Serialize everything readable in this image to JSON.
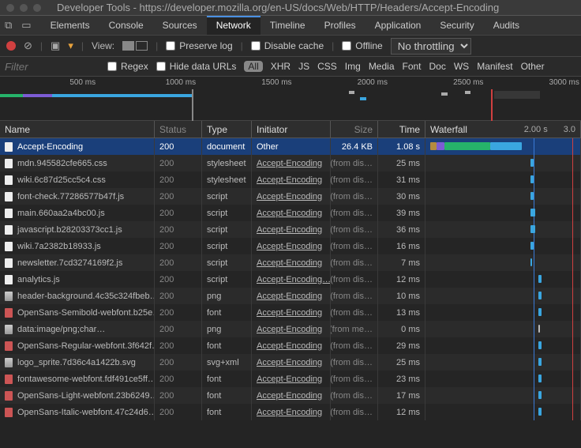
{
  "titlebar": {
    "title": "Developer Tools - https://developer.mozilla.org/en-US/docs/Web/HTTP/Headers/Accept-Encoding"
  },
  "tabs": {
    "items": [
      {
        "label": "Elements"
      },
      {
        "label": "Console"
      },
      {
        "label": "Sources"
      },
      {
        "label": "Network"
      },
      {
        "label": "Timeline"
      },
      {
        "label": "Profiles"
      },
      {
        "label": "Application"
      },
      {
        "label": "Security"
      },
      {
        "label": "Audits"
      }
    ],
    "active": 3
  },
  "toolbar": {
    "view_label": "View:",
    "preserve_log": "Preserve log",
    "disable_cache": "Disable cache",
    "offline": "Offline",
    "throttling": "No throttling"
  },
  "filter": {
    "placeholder": "Filter",
    "regex": "Regex",
    "hide_data": "Hide data URLs",
    "types": [
      "All",
      "XHR",
      "JS",
      "CSS",
      "Img",
      "Media",
      "Font",
      "Doc",
      "WS",
      "Manifest",
      "Other"
    ]
  },
  "overview": {
    "ticks": [
      "500 ms",
      "1000 ms",
      "1500 ms",
      "2000 ms",
      "2500 ms",
      "3000 ms"
    ]
  },
  "headers": {
    "name": "Name",
    "status": "Status",
    "type": "Type",
    "initiator": "Initiator",
    "size": "Size",
    "time": "Time",
    "waterfall": "Waterfall",
    "wf_t1": "2.00 s",
    "wf_t2": "3.0"
  },
  "rows": [
    {
      "name": "Accept-Encoding",
      "status": "200",
      "type": "document",
      "init": "Other",
      "init_u": false,
      "size": "26.4 KB",
      "time": "1.08 s",
      "icon": "doc",
      "selected": true,
      "wf": [
        {
          "l": 3,
          "w": 4,
          "c": "#b58b3f"
        },
        {
          "l": 7,
          "w": 5,
          "c": "#7c5cd4"
        },
        {
          "l": 12,
          "w": 30,
          "c": "#26b36a"
        },
        {
          "l": 42,
          "w": 20,
          "c": "#3aa6e0"
        }
      ]
    },
    {
      "name": "mdn.945582cfe665.css",
      "status": "200",
      "type": "stylesheet",
      "init": "Accept-Encoding",
      "init_u": true,
      "size": "(from dis…",
      "time": "25 ms",
      "icon": "doc",
      "wf": [
        {
          "l": 68,
          "w": 2,
          "c": "#3aa6e0"
        }
      ]
    },
    {
      "name": "wiki.6c87d25cc5c4.css",
      "status": "200",
      "type": "stylesheet",
      "init": "Accept-Encoding",
      "init_u": true,
      "size": "(from dis…",
      "time": "31 ms",
      "icon": "doc",
      "wf": [
        {
          "l": 68,
          "w": 2,
          "c": "#3aa6e0"
        }
      ]
    },
    {
      "name": "font-check.77286577b47f.js",
      "status": "200",
      "type": "script",
      "init": "Accept-Encoding",
      "init_u": true,
      "size": "(from dis…",
      "time": "30 ms",
      "icon": "doc",
      "wf": [
        {
          "l": 68,
          "w": 2,
          "c": "#3aa6e0"
        }
      ]
    },
    {
      "name": "main.660aa2a4bc00.js",
      "status": "200",
      "type": "script",
      "init": "Accept-Encoding",
      "init_u": true,
      "size": "(from dis…",
      "time": "39 ms",
      "icon": "doc",
      "wf": [
        {
          "l": 68,
          "w": 3,
          "c": "#3aa6e0"
        }
      ]
    },
    {
      "name": "javascript.b28203373cc1.js",
      "status": "200",
      "type": "script",
      "init": "Accept-Encoding",
      "init_u": true,
      "size": "(from dis…",
      "time": "36 ms",
      "icon": "doc",
      "wf": [
        {
          "l": 68,
          "w": 3,
          "c": "#3aa6e0"
        }
      ]
    },
    {
      "name": "wiki.7a2382b18933.js",
      "status": "200",
      "type": "script",
      "init": "Accept-Encoding",
      "init_u": true,
      "size": "(from dis…",
      "time": "16 ms",
      "icon": "doc",
      "wf": [
        {
          "l": 68,
          "w": 2,
          "c": "#3aa6e0"
        }
      ]
    },
    {
      "name": "newsletter.7cd3274169f2.js",
      "status": "200",
      "type": "script",
      "init": "Accept-Encoding",
      "init_u": true,
      "size": "(from dis…",
      "time": "7 ms",
      "icon": "doc",
      "wf": [
        {
          "l": 68,
          "w": 1,
          "c": "#3aa6e0"
        }
      ]
    },
    {
      "name": "analytics.js",
      "status": "200",
      "type": "script",
      "init": "Accept-Encoding…",
      "init_u": true,
      "size": "(from dis…",
      "time": "12 ms",
      "icon": "doc",
      "wf": [
        {
          "l": 73,
          "w": 2,
          "c": "#3aa6e0"
        }
      ]
    },
    {
      "name": "header-background.4c35c324fbeb…",
      "status": "200",
      "type": "png",
      "init": "Accept-Encoding",
      "init_u": true,
      "size": "(from dis…",
      "time": "10 ms",
      "icon": "img",
      "wf": [
        {
          "l": 73,
          "w": 2,
          "c": "#3aa6e0"
        }
      ]
    },
    {
      "name": "OpenSans-Semibold-webfont.b25e…",
      "status": "200",
      "type": "font",
      "init": "Accept-Encoding",
      "init_u": true,
      "size": "(from dis…",
      "time": "13 ms",
      "icon": "font",
      "wf": [
        {
          "l": 73,
          "w": 2,
          "c": "#3aa6e0"
        }
      ]
    },
    {
      "name": "data:image/png;char…",
      "status": "200",
      "type": "png",
      "init": "Accept-Encoding",
      "init_u": true,
      "size": "(from me…",
      "time": "0 ms",
      "icon": "img",
      "wf": [
        {
          "l": 73,
          "w": 1,
          "c": "#bbb"
        }
      ]
    },
    {
      "name": "OpenSans-Regular-webfont.3f642f…",
      "status": "200",
      "type": "font",
      "init": "Accept-Encoding",
      "init_u": true,
      "size": "(from dis…",
      "time": "29 ms",
      "icon": "font",
      "wf": [
        {
          "l": 73,
          "w": 2,
          "c": "#3aa6e0"
        }
      ]
    },
    {
      "name": "logo_sprite.7d36c4a1422b.svg",
      "status": "200",
      "type": "svg+xml",
      "init": "Accept-Encoding",
      "init_u": true,
      "size": "(from dis…",
      "time": "25 ms",
      "icon": "img",
      "wf": [
        {
          "l": 73,
          "w": 2,
          "c": "#3aa6e0"
        }
      ]
    },
    {
      "name": "fontawesome-webfont.fdf491ce5ff…",
      "status": "200",
      "type": "font",
      "init": "Accept-Encoding",
      "init_u": true,
      "size": "(from dis…",
      "time": "23 ms",
      "icon": "font",
      "wf": [
        {
          "l": 73,
          "w": 2,
          "c": "#3aa6e0"
        }
      ]
    },
    {
      "name": "OpenSans-Light-webfont.23b6249…",
      "status": "200",
      "type": "font",
      "init": "Accept-Encoding",
      "init_u": true,
      "size": "(from dis…",
      "time": "17 ms",
      "icon": "font",
      "wf": [
        {
          "l": 73,
          "w": 2,
          "c": "#3aa6e0"
        }
      ]
    },
    {
      "name": "OpenSans-Italic-webfont.47c24d6…",
      "status": "200",
      "type": "font",
      "init": "Accept-Encoding",
      "init_u": true,
      "size": "(from dis…",
      "time": "12 ms",
      "icon": "font",
      "wf": [
        {
          "l": 73,
          "w": 2,
          "c": "#3aa6e0"
        }
      ]
    }
  ]
}
